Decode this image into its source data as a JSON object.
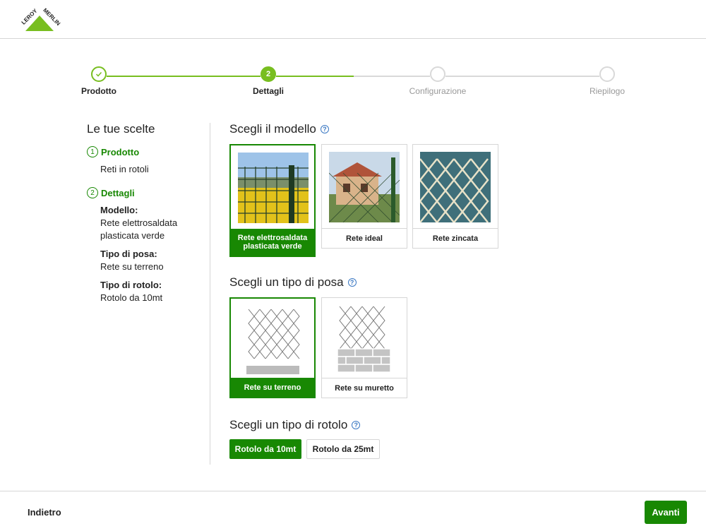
{
  "brand": {
    "name": "LEROY MERLIN",
    "color": "#78be20"
  },
  "stepper": {
    "steps": [
      {
        "label": "Prodotto",
        "state": "done",
        "icon": "check-icon"
      },
      {
        "label": "Dettagli",
        "state": "current",
        "number": "2"
      },
      {
        "label": "Configurazione",
        "state": "todo"
      },
      {
        "label": "Riepilogo",
        "state": "todo"
      }
    ]
  },
  "summary": {
    "title": "Le tue scelte",
    "step1": {
      "number": "1",
      "label": "Prodotto",
      "value": "Reti in rotoli"
    },
    "step2": {
      "number": "2",
      "label": "Dettagli",
      "fields": [
        {
          "key": "Modello:",
          "value": "Rete elettrosaldata plasticata verde"
        },
        {
          "key": "Tipo di posa:",
          "value": "Rete su terreno"
        },
        {
          "key": "Tipo di rotolo:",
          "value": "Rotolo da 10mt"
        }
      ]
    }
  },
  "model": {
    "title": "Scegli il modello",
    "options": [
      {
        "label": "Rete elettrosaldata plasticata verde",
        "selected": true
      },
      {
        "label": "Rete ideal",
        "selected": false
      },
      {
        "label": "Rete zincata",
        "selected": false
      }
    ]
  },
  "posa": {
    "title": "Scegli un tipo di posa",
    "options": [
      {
        "label": "Rete su terreno",
        "selected": true
      },
      {
        "label": "Rete su muretto",
        "selected": false
      }
    ]
  },
  "rotolo": {
    "title": "Scegli un tipo di rotolo",
    "options": [
      {
        "label": "Rotolo da 10mt",
        "selected": true
      },
      {
        "label": "Rotolo da 25mt",
        "selected": false
      }
    ]
  },
  "footer": {
    "back_label": "Indietro",
    "next_label": "Avanti"
  },
  "colors": {
    "accent_dark": "#188803",
    "accent_light": "#78be20",
    "help": "#3a78c3"
  }
}
